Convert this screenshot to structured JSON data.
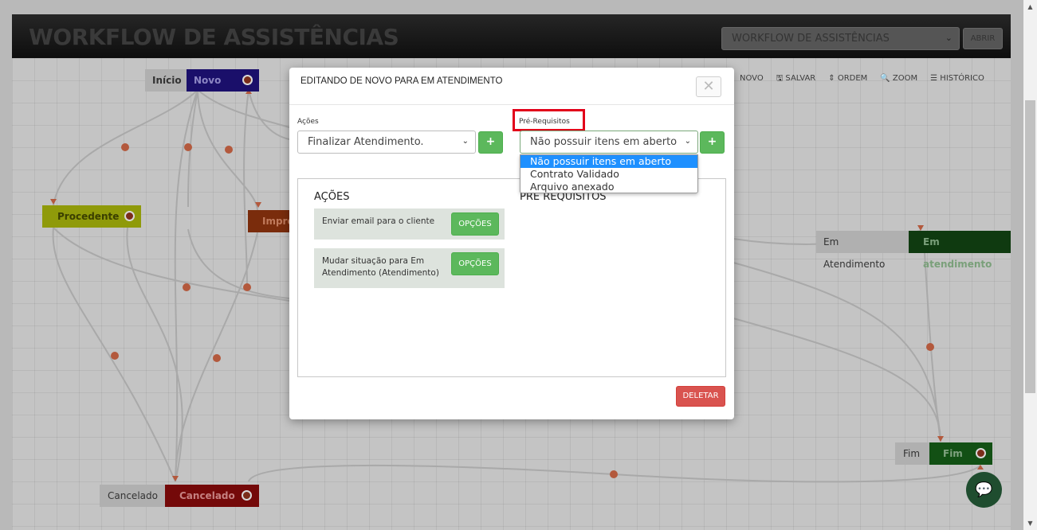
{
  "header": {
    "title": "WORKFLOW DE ASSISTÊNCIAS",
    "workflow_select": "WORKFLOW DE ASSISTÊNCIAS",
    "open_button": "ABRIR"
  },
  "toolbar": [
    {
      "label": "NOVO",
      "icon": "new-icon"
    },
    {
      "label": "🖫 SALVAR",
      "icon": "save-icon"
    },
    {
      "label": "⇕ ORDEM",
      "icon": "order-icon"
    },
    {
      "label": "🔍 ZOOM",
      "icon": "zoom-icon"
    },
    {
      "label": "☰ HISTÓRICO",
      "icon": "history-icon"
    }
  ],
  "nodes": {
    "inicio": "Início",
    "novo": "Novo",
    "procedente": "Procedente",
    "impro": "Impro",
    "em_atendimento_gray": "Em Atendimento",
    "em_atendimento": "Em atendimento",
    "fim_gray": "Fim",
    "fim": "Fim",
    "cancelado_gray": "Cancelado",
    "cancelado": "Cancelado"
  },
  "modal": {
    "title": "EDITANDO DE NOVO PARA EM ATENDIMENTO",
    "close_icon": "close-icon",
    "acoes_label": "Ações",
    "acoes_value": "Finalizar Atendimento.",
    "prereq_label": "Pré-Requisitos",
    "prereq_value": "Não possuir itens em aberto",
    "prereq_options": [
      "Não possuir itens em aberto",
      "Contrato Validado",
      "Arquivo anexado"
    ],
    "add_label": "+",
    "panel": {
      "acoes_heading": "AÇÕES",
      "prereq_heading": "PRE REQUISITOS",
      "items": [
        {
          "text": "Enviar email para o cliente",
          "button": "OPÇÕES"
        },
        {
          "text": "Mudar situação para Em Atendimento (Atendimento)",
          "button": "OPÇÕES"
        }
      ]
    },
    "delete_button": "DELETAR"
  },
  "colors": {
    "accent_green": "#5cb85c",
    "danger_red": "#d9534f",
    "highlight_red": "#e2001a",
    "selected_blue": "#1e90ff"
  }
}
